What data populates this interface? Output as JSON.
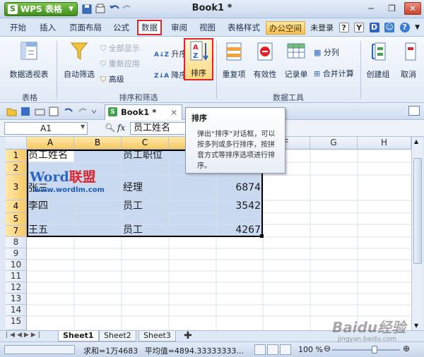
{
  "app": {
    "menu_button": "WPS 表格",
    "doc_title": "Book1 *"
  },
  "menu_tabs": [
    {
      "label": "开始"
    },
    {
      "label": "插入"
    },
    {
      "label": "页面布局"
    },
    {
      "label": "公式"
    },
    {
      "label": "数据"
    },
    {
      "label": "审阅"
    },
    {
      "label": "视图"
    },
    {
      "label": "表格样式"
    },
    {
      "label": "办公空间"
    }
  ],
  "menu_right": {
    "login": "未登录"
  },
  "ribbon": {
    "pivot": "数据透视表",
    "autofilter": "自动筛选",
    "show_all": "全部显示",
    "reapply": "重新应用",
    "advanced": "高级",
    "asc": "升序",
    "desc": "降序",
    "sort": "排序",
    "duplicates": "重复项",
    "validity": "有效性",
    "record": "记录单",
    "split": "分列",
    "consolidate": "合并计算",
    "create_group": "创建组",
    "cancel": "取消",
    "group_table": "表格",
    "group_sort_filter": "排序和筛选",
    "group_data_tools": "数据工具"
  },
  "doc_tab": {
    "name": "Book1 *"
  },
  "formula": {
    "namebox": "A1",
    "fx": "fx",
    "value": "员工姓名"
  },
  "grid": {
    "columns": [
      "A",
      "B",
      "C",
      "D",
      "E",
      "F",
      "G",
      "H"
    ],
    "rows": [
      "1",
      "2",
      "3",
      "4",
      "5",
      "6",
      "7",
      "8",
      "9",
      "10",
      "11",
      "12",
      "13",
      "14",
      "15"
    ],
    "cells": {
      "A1": "员工姓名",
      "C1": "员工职位",
      "A3": "张三",
      "C3": "经理",
      "E3": "6874",
      "A5": "李四",
      "C5": "员工",
      "E5": "3542",
      "A7": "王五",
      "C7": "员工",
      "E7": "4267"
    }
  },
  "watermark": {
    "brand_a": "Word",
    "brand_b": "联盟",
    "url": "www.wordlm.com"
  },
  "sheets": [
    "Sheet1",
    "Sheet2",
    "Sheet3"
  ],
  "status": {
    "sum": "求和=1万4683",
    "avg": "平均值=4894.33333333...",
    "zoom": "100 %",
    "zoom_level_percent": 100
  },
  "tooltip": {
    "title": "排序",
    "body": "弹出“排序”对话框，可以按多列或多行排序，按拼音方式等排序选项进行排序。"
  },
  "baidu": {
    "logo": "Baidu经验",
    "url": "jingyan.baidu.com"
  },
  "colors": {
    "accent": "#e0232d",
    "selection": "#c9daf0",
    "wps_green": "#3f8f1e"
  }
}
